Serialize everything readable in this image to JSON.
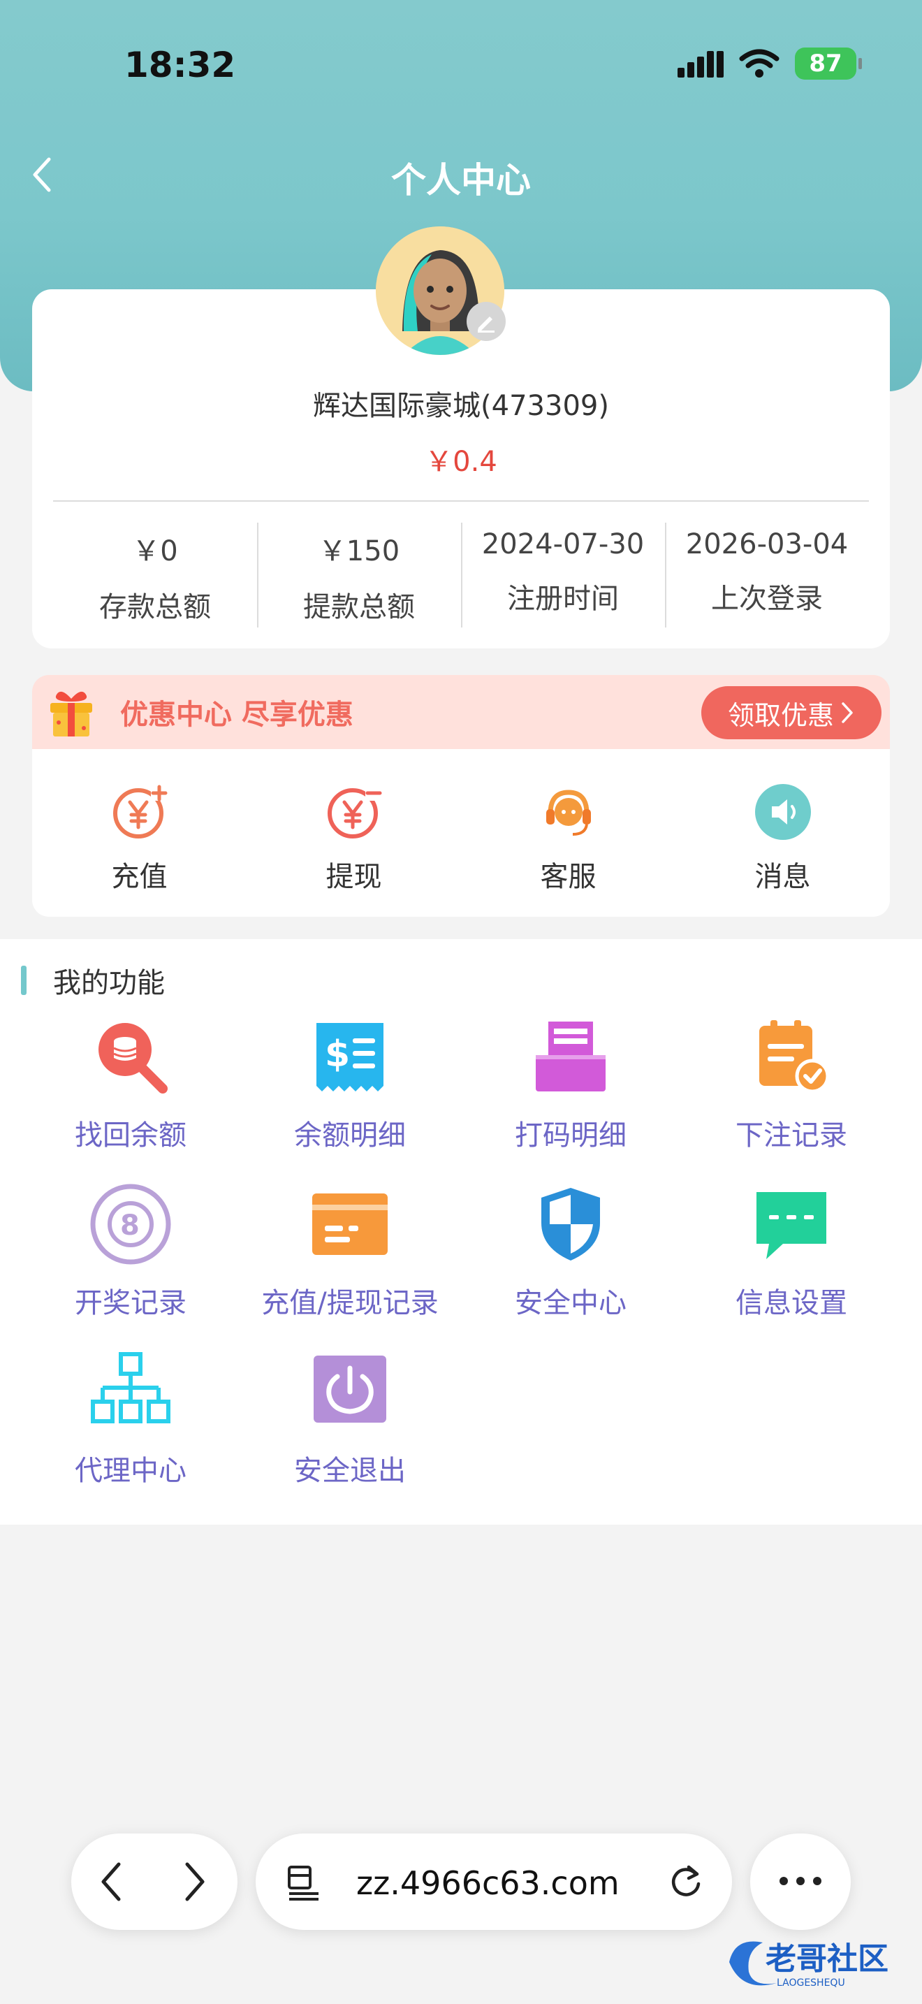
{
  "status_bar": {
    "time": "18:32",
    "battery": "87"
  },
  "nav": {
    "title": "个人中心"
  },
  "profile": {
    "username": "辉达国际豪城(473309)",
    "balance": "￥0.4",
    "stats": [
      {
        "value": "￥0",
        "label": "存款总额"
      },
      {
        "value": "￥150",
        "label": "提款总额"
      },
      {
        "value": "2024-07-30",
        "label": "注册时间"
      },
      {
        "value": "2026-03-04",
        "label": "上次登录"
      }
    ]
  },
  "promo": {
    "text": "优惠中心 尽享优惠",
    "button": "领取优惠"
  },
  "quick_actions": [
    {
      "label": "充值",
      "icon": "deposit-yen-plus-icon"
    },
    {
      "label": "提现",
      "icon": "withdraw-yen-minus-icon"
    },
    {
      "label": "客服",
      "icon": "headset-icon"
    },
    {
      "label": "消息",
      "icon": "speaker-icon"
    }
  ],
  "functions": {
    "title": "我的功能",
    "items": [
      {
        "label": "找回余额",
        "icon": "search-coins-icon",
        "color": "#f0625a"
      },
      {
        "label": "余额明细",
        "icon": "receipt-dollar-icon",
        "color": "#27b6ee"
      },
      {
        "label": "打码明细",
        "icon": "printer-icon",
        "color": "#d25ad9"
      },
      {
        "label": "下注记录",
        "icon": "clipboard-check-icon",
        "color": "#f79a3b"
      },
      {
        "label": "开奖记录",
        "icon": "lottery-ball-icon",
        "color": "#b9a1d8"
      },
      {
        "label": "充值/提现记录",
        "icon": "card-icon",
        "color": "#f7993b"
      },
      {
        "label": "安全中心",
        "icon": "shield-icon",
        "color": "#2a8fd8"
      },
      {
        "label": "信息设置",
        "icon": "chat-bubble-icon",
        "color": "#22d09a"
      },
      {
        "label": "代理中心",
        "icon": "org-chart-icon",
        "color": "#2ad0ec"
      },
      {
        "label": "安全退出",
        "icon": "power-icon",
        "color": "#b48fd8"
      }
    ]
  },
  "browser": {
    "url": "zz.4966c63.com"
  },
  "watermark": {
    "text": "老哥社区",
    "sub": "LAOGESHEQU"
  }
}
